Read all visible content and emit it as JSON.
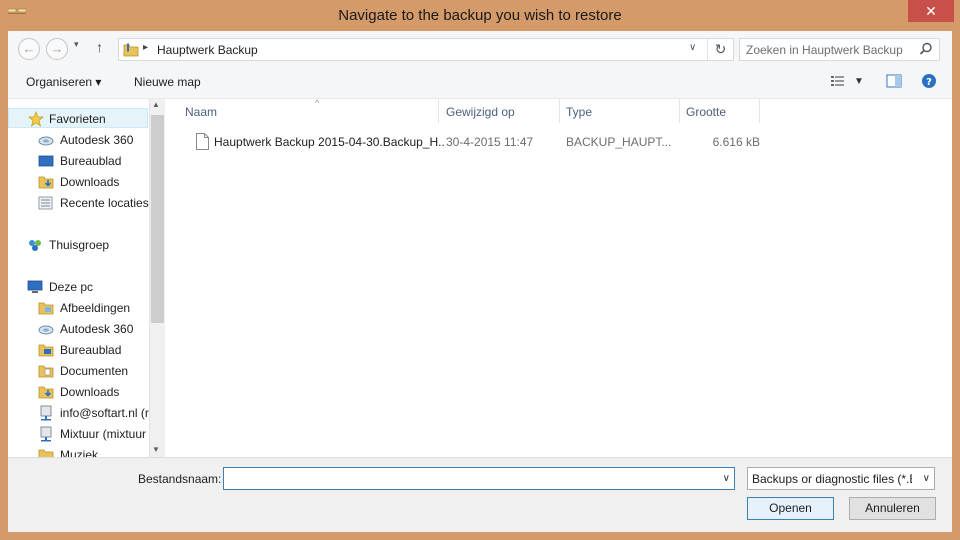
{
  "window": {
    "title": "Navigate to the backup you wish to restore",
    "close_glyph": "✕"
  },
  "address": {
    "back_glyph": "←",
    "forward_glyph": "→",
    "up_glyph": "↑",
    "breadcrumb": "Hauptwerk Backup",
    "refresh_glyph": "↻"
  },
  "search": {
    "placeholder": "Zoeken in Hauptwerk Backup"
  },
  "toolbar": {
    "organize_label": "Organiseren ▾",
    "new_folder_label": "Nieuwe map"
  },
  "nav": {
    "favorites": {
      "label": "Favorieten",
      "items": [
        {
          "label": "Autodesk 360",
          "icon": "cloud-icon"
        },
        {
          "label": "Bureaublad",
          "icon": "desktop-icon"
        },
        {
          "label": "Downloads",
          "icon": "downloads-folder-icon"
        },
        {
          "label": "Recente locaties",
          "icon": "recent-places-icon"
        }
      ]
    },
    "homegroup": {
      "label": "Thuisgroep"
    },
    "this_pc": {
      "label": "Deze pc",
      "items": [
        {
          "label": "Afbeeldingen",
          "icon": "pictures-folder-icon"
        },
        {
          "label": "Autodesk 360",
          "icon": "cloud-icon"
        },
        {
          "label": "Bureaublad",
          "icon": "desktop-folder-icon"
        },
        {
          "label": "Documenten",
          "icon": "documents-folder-icon"
        },
        {
          "label": "Downloads",
          "icon": "downloads-folder-icon"
        },
        {
          "label": "info@softart.nl (r",
          "icon": "network-drive-icon"
        },
        {
          "label": "Mixtuur (mixtuur",
          "icon": "network-drive-icon"
        },
        {
          "label": "Muziek",
          "icon": "music-folder-icon"
        }
      ]
    }
  },
  "files": {
    "columns": [
      "Naam",
      "Gewijzigd op",
      "Type",
      "Grootte"
    ],
    "rows": [
      {
        "name": "Hauptwerk Backup 2015-04-30.Backup_H...",
        "modified": "30-4-2015 11:47",
        "type": "BACKUP_HAUPT...",
        "size": "6.616 kB"
      }
    ]
  },
  "bottom": {
    "filename_label": "Bestandsnaam:",
    "filename_value": "",
    "filter_value": "Backups or diagnostic files (*.Backup_Hauptwerk)",
    "open_label": "Openen",
    "cancel_label": "Annuleren"
  },
  "colors": {
    "frame": "#d49a6a",
    "close": "#c7504b",
    "selection": "#e5f3fb",
    "focus_border": "#3c7fb1"
  }
}
